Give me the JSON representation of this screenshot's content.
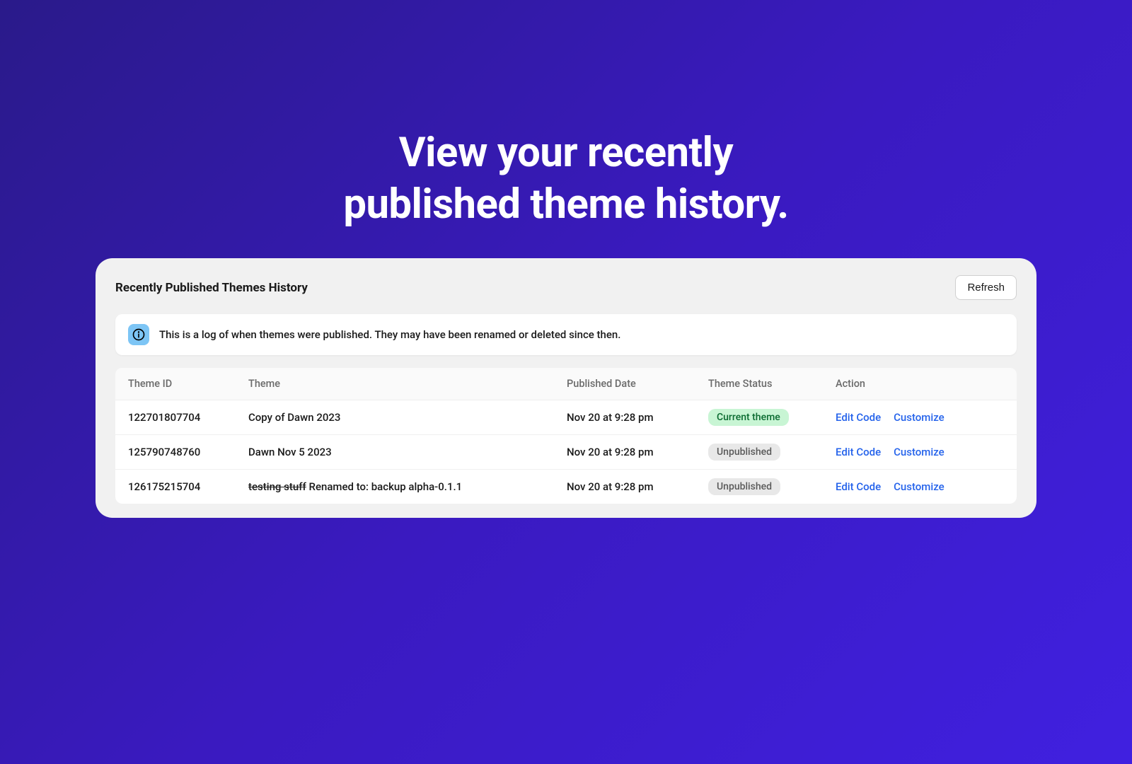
{
  "hero": {
    "line1": "View your recently",
    "line2": "published theme history."
  },
  "card": {
    "title": "Recently Published Themes History",
    "refresh": "Refresh",
    "info": "This is a log of when themes were published. They may have been renamed or deleted since then."
  },
  "table": {
    "headers": {
      "theme_id": "Theme ID",
      "theme": "Theme",
      "published_date": "Published Date",
      "theme_status": "Theme Status",
      "action": "Action"
    },
    "rows": [
      {
        "id": "122701807704",
        "theme": "Copy of Dawn 2023",
        "strike": "",
        "rename": "",
        "date": "Nov 20 at 9:28 pm",
        "status": "Current theme",
        "status_type": "current"
      },
      {
        "id": "125790748760",
        "theme": "Dawn Nov 5 2023",
        "strike": "",
        "rename": "",
        "date": "Nov 20 at 9:28 pm",
        "status": "Unpublished",
        "status_type": "unpublished"
      },
      {
        "id": "126175215704",
        "theme": "",
        "strike": "testing stuff",
        "rename": " Renamed to: backup alpha-0.1.1",
        "date": "Nov 20 at 9:28 pm",
        "status": "Unpublished",
        "status_type": "unpublished"
      }
    ],
    "actions": {
      "edit": "Edit Code",
      "customize": "Customize"
    }
  }
}
